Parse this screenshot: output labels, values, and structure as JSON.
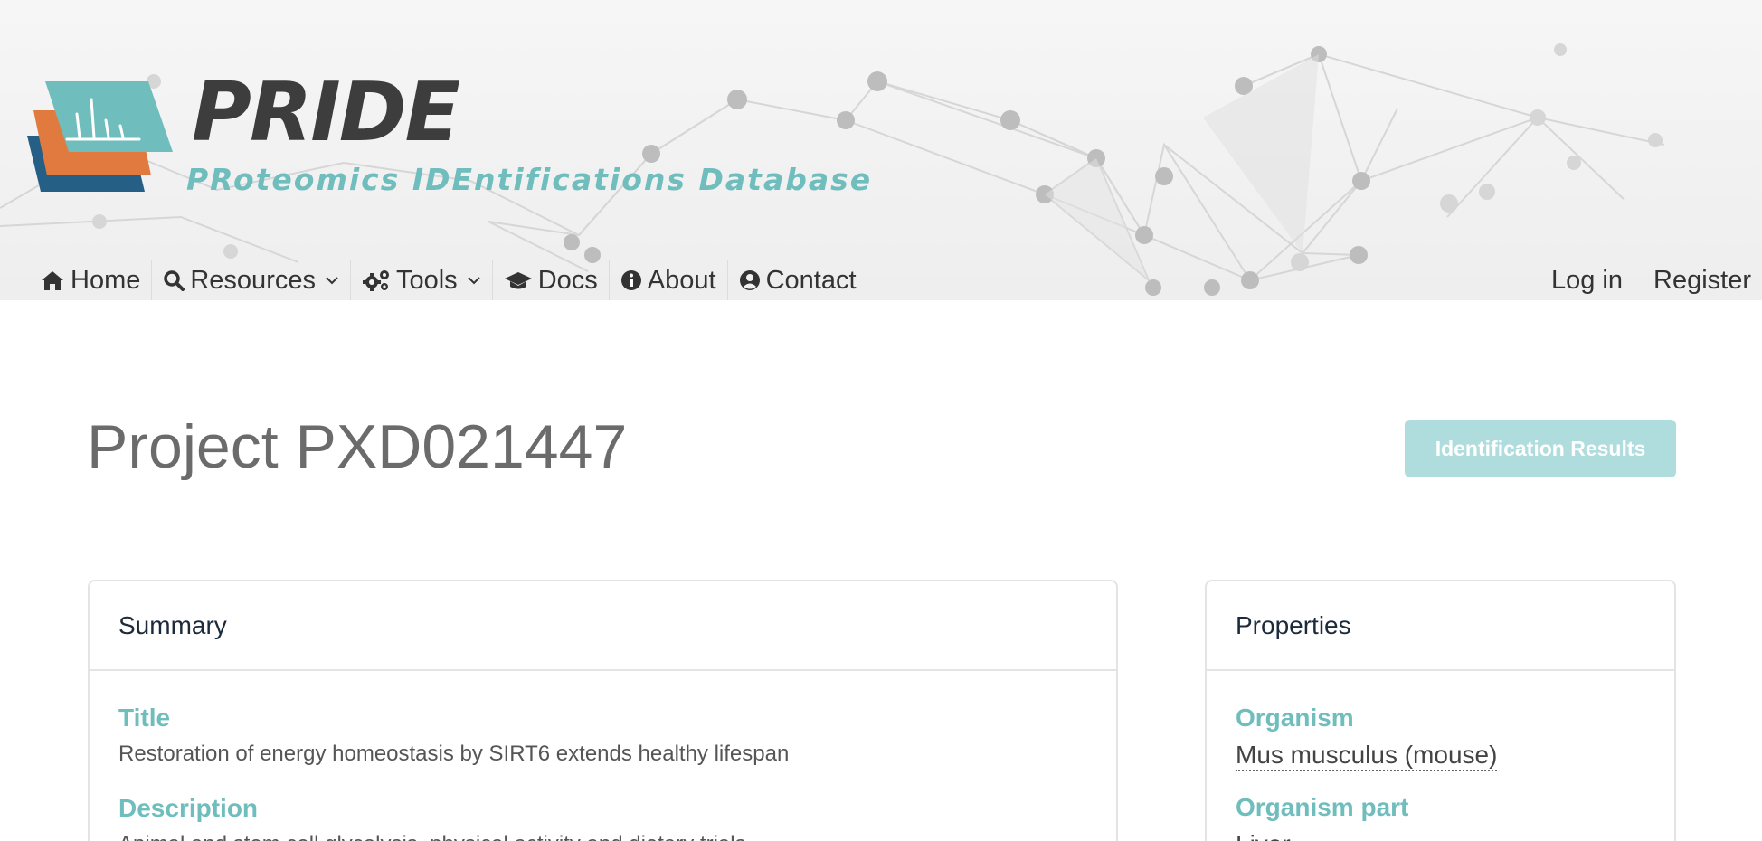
{
  "brand": {
    "name": "PRIDE",
    "subtitle": "PRoteomics IDEntifications Database"
  },
  "nav": {
    "items": [
      {
        "label": "Home",
        "icon": "home-icon"
      },
      {
        "label": "Resources",
        "icon": "search-icon",
        "dropdown": true
      },
      {
        "label": "Tools",
        "icon": "cogs-icon",
        "dropdown": true
      },
      {
        "label": "Docs",
        "icon": "graduation-cap-icon"
      },
      {
        "label": "About",
        "icon": "info-circle-icon"
      },
      {
        "label": "Contact",
        "icon": "user-circle-icon"
      }
    ],
    "login": "Log in",
    "register": "Register"
  },
  "project": {
    "title": "Project PXD021447",
    "identification_button": "Identification Results"
  },
  "summary": {
    "heading": "Summary",
    "title_label": "Title",
    "title_value": "Restoration of energy homeostasis by SIRT6 extends healthy lifespan",
    "description_label": "Description",
    "description_value": "Animal and stem cell glycolysis, physical activity and dietary trials"
  },
  "properties": {
    "heading": "Properties",
    "organism_label": "Organism",
    "organism_value": "Mus musculus (mouse)",
    "organism_part_label": "Organism part",
    "organism_part_value": "Liver"
  },
  "colors": {
    "accent": "#6fbdbd",
    "button": "#afdcdc",
    "logo_teal": "#6fbdbd",
    "logo_orange": "#e07a3e",
    "logo_blue": "#255f86"
  }
}
